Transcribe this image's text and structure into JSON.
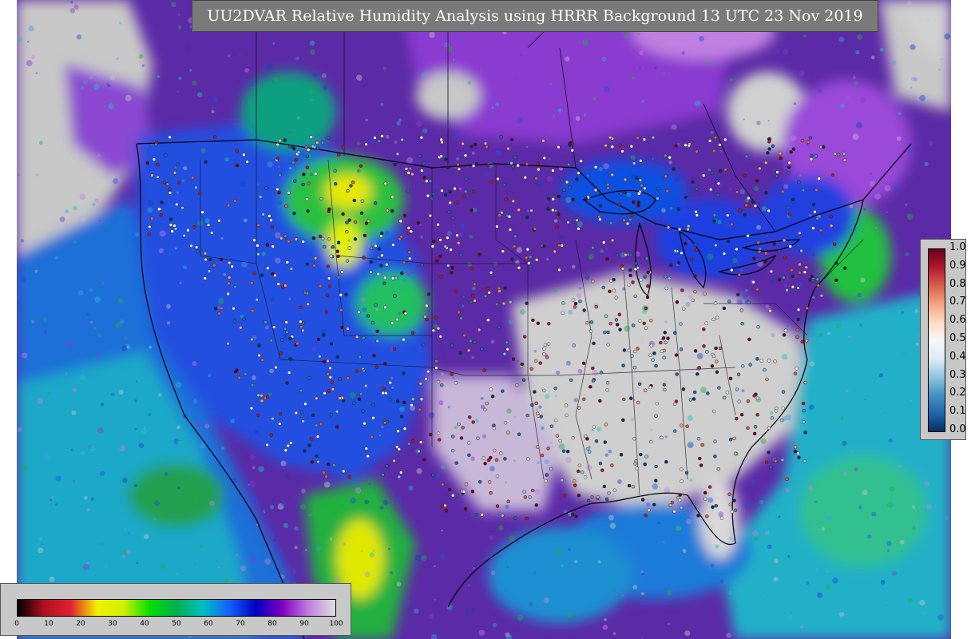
{
  "title": "UU2DVAR Relative Humidity Analysis using HRRR Background 13 UTC 23 Nov 2019",
  "colorbar_main": {
    "ticks": [
      "0",
      "10",
      "20",
      "30",
      "40",
      "50",
      "60",
      "70",
      "80",
      "90",
      "100"
    ],
    "colors": [
      "#000000",
      "#b01020",
      "#e02030",
      "#f0f000",
      "#d0f000",
      "#00e000",
      "#00b050",
      "#00c0c0",
      "#1060ff",
      "#0000c0",
      "#8000c0",
      "#c080e0",
      "#e0e0e0"
    ]
  },
  "colorbar_obs": {
    "ticks": [
      "1.0",
      "0.9",
      "0.8",
      "0.7",
      "0.6",
      "0.5",
      "0.4",
      "0.3",
      "0.2",
      "0.1",
      "0.0"
    ],
    "colors": [
      "#67001f",
      "#b2182b",
      "#d6604d",
      "#f4a582",
      "#fddbc7",
      "#f7f7f7",
      "#e0ecf4",
      "#92c5de",
      "#4393c3",
      "#2166ac",
      "#053061"
    ]
  }
}
